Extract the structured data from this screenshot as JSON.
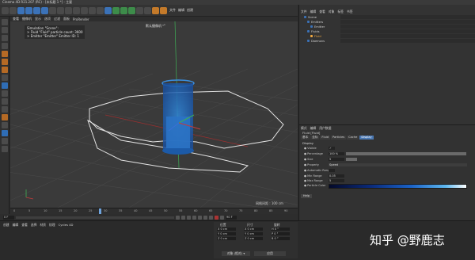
{
  "app": {
    "title": "Cinema 4D R21.207 (RC) - [未标题 1 *] - 主要"
  },
  "toolbar": {
    "menus": [
      "文件",
      "编辑",
      "创建",
      "模式",
      "选择",
      "工具",
      "网格",
      "样条",
      "体积",
      "运动图形",
      "角色",
      "动画",
      "模拟",
      "跟踪器",
      "渲染",
      "扩展",
      "INSYDIUM",
      "Redshift",
      "窗口",
      "帮助",
      "RealFlow"
    ]
  },
  "viewport": {
    "menus": [
      "查看",
      "摄像机",
      "显示",
      "选项",
      "过滤",
      "面板",
      "ProRender"
    ],
    "view_label": "默认摄像机 ⁰°",
    "hud": {
      "line1": "Simulation \"Scene\":",
      "line2": "> Fluid \"Fluid\" particle count: 3600",
      "line3": "> Emitter \"Emitter\" Emitter ID: 1"
    },
    "grid_spacing": "网格间距 : 100 cm"
  },
  "timeline": {
    "ticks": [
      "0",
      "5",
      "10",
      "15",
      "20",
      "25",
      "30",
      "35",
      "40",
      "45",
      "50",
      "55",
      "60",
      "65",
      "70",
      "75",
      "80",
      "85",
      "90"
    ],
    "start_field": "0 F",
    "end_field": "90 F"
  },
  "material_bar": {
    "menus": [
      "创建",
      "编辑",
      "查看",
      "选择",
      "材质",
      "纹理",
      "Cycles 4D"
    ]
  },
  "coordinates": {
    "pos_header": "位置",
    "size_header": "尺寸",
    "rot_header": "旋转",
    "x": "X  0 cm",
    "y": "Y  0 cm",
    "z": "Z  0 cm",
    "sx": "X  0 cm",
    "sy": "Y  0 cm",
    "sz": "Z  0 cm",
    "h": "H  0 °",
    "p": "P  0 °",
    "b": "B  0 °",
    "mode_label": "对象 (相对) ▾",
    "apply_label": "应用"
  },
  "object_manager": {
    "menus": [
      "文件",
      "编辑",
      "查看",
      "对象",
      "标签",
      "书签"
    ],
    "rows": [
      {
        "label": "Scene",
        "color": "#3b72b8"
      },
      {
        "label": "Emitters",
        "color": "#3b72b8"
      },
      {
        "label": "Emitter",
        "color": "#3b72b8"
      },
      {
        "label": "Fluids",
        "color": "#3b72b8"
      },
      {
        "label": "Fluid",
        "color": "#f0a840"
      },
      {
        "label": "Daemons",
        "color": "#3b72b8"
      }
    ]
  },
  "attribute_manager": {
    "menus": [
      "模式",
      "编辑",
      "用户数据"
    ],
    "object_title": "Fluid [Fluid]",
    "tabs": [
      "基本",
      "坐标",
      "Fluid",
      "Particles",
      "Cache",
      "Display"
    ],
    "section": "Display",
    "rows": [
      {
        "label": "● Visible",
        "value": "✓"
      },
      {
        "label": "● Percentage",
        "value": "100 %"
      },
      {
        "label": "● Size",
        "value": "5"
      },
      {
        "label": "● Property",
        "value": "Speed"
      },
      {
        "label": "● Automatic Range",
        "value": ""
      },
      {
        "label": "● Min Range",
        "value": "0.05"
      },
      {
        "label": "● Max Range",
        "value": "5"
      },
      {
        "label": "● Particle Color",
        "value": ""
      }
    ],
    "help_label": "Help"
  },
  "watermark": "知乎 @野鹿志"
}
